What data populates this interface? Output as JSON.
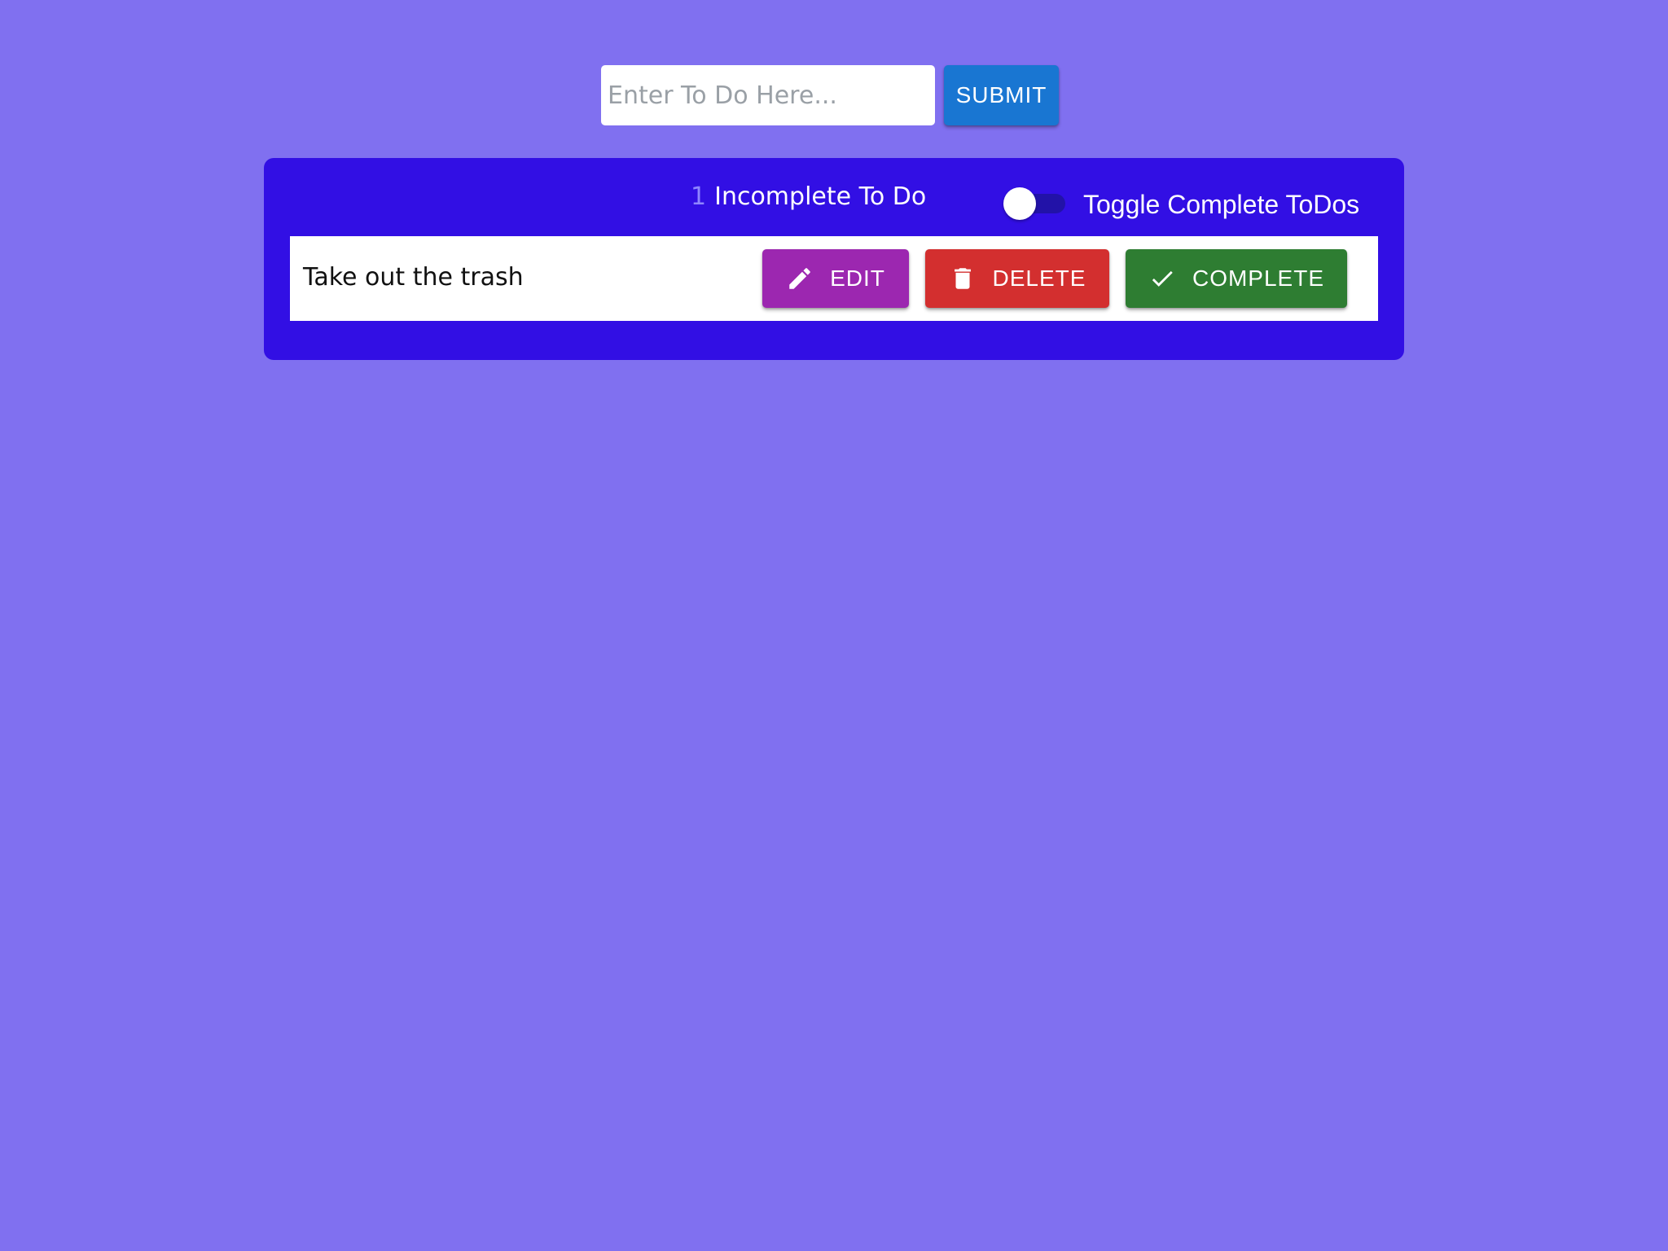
{
  "form": {
    "input_placeholder": "Enter To Do Here...",
    "input_value": "",
    "submit_label": "SUBMIT"
  },
  "panel": {
    "incomplete_count": "1",
    "incomplete_label": "Incomplete To Do",
    "toggle_label": "Toggle Complete ToDos",
    "toggle_on": false
  },
  "todos": [
    {
      "text": "Take out the trash",
      "edit_label": "EDIT",
      "delete_label": "DELETE",
      "complete_label": "COMPLETE"
    }
  ],
  "icons": {
    "edit": "pencil-icon",
    "delete": "trash-icon",
    "complete": "check-icon"
  },
  "colors": {
    "background": "#8070F0",
    "panel": "#320FE4",
    "submit": "#1976D2",
    "edit": "#9C27B0",
    "delete": "#D32F2F",
    "complete": "#2E7D32"
  }
}
